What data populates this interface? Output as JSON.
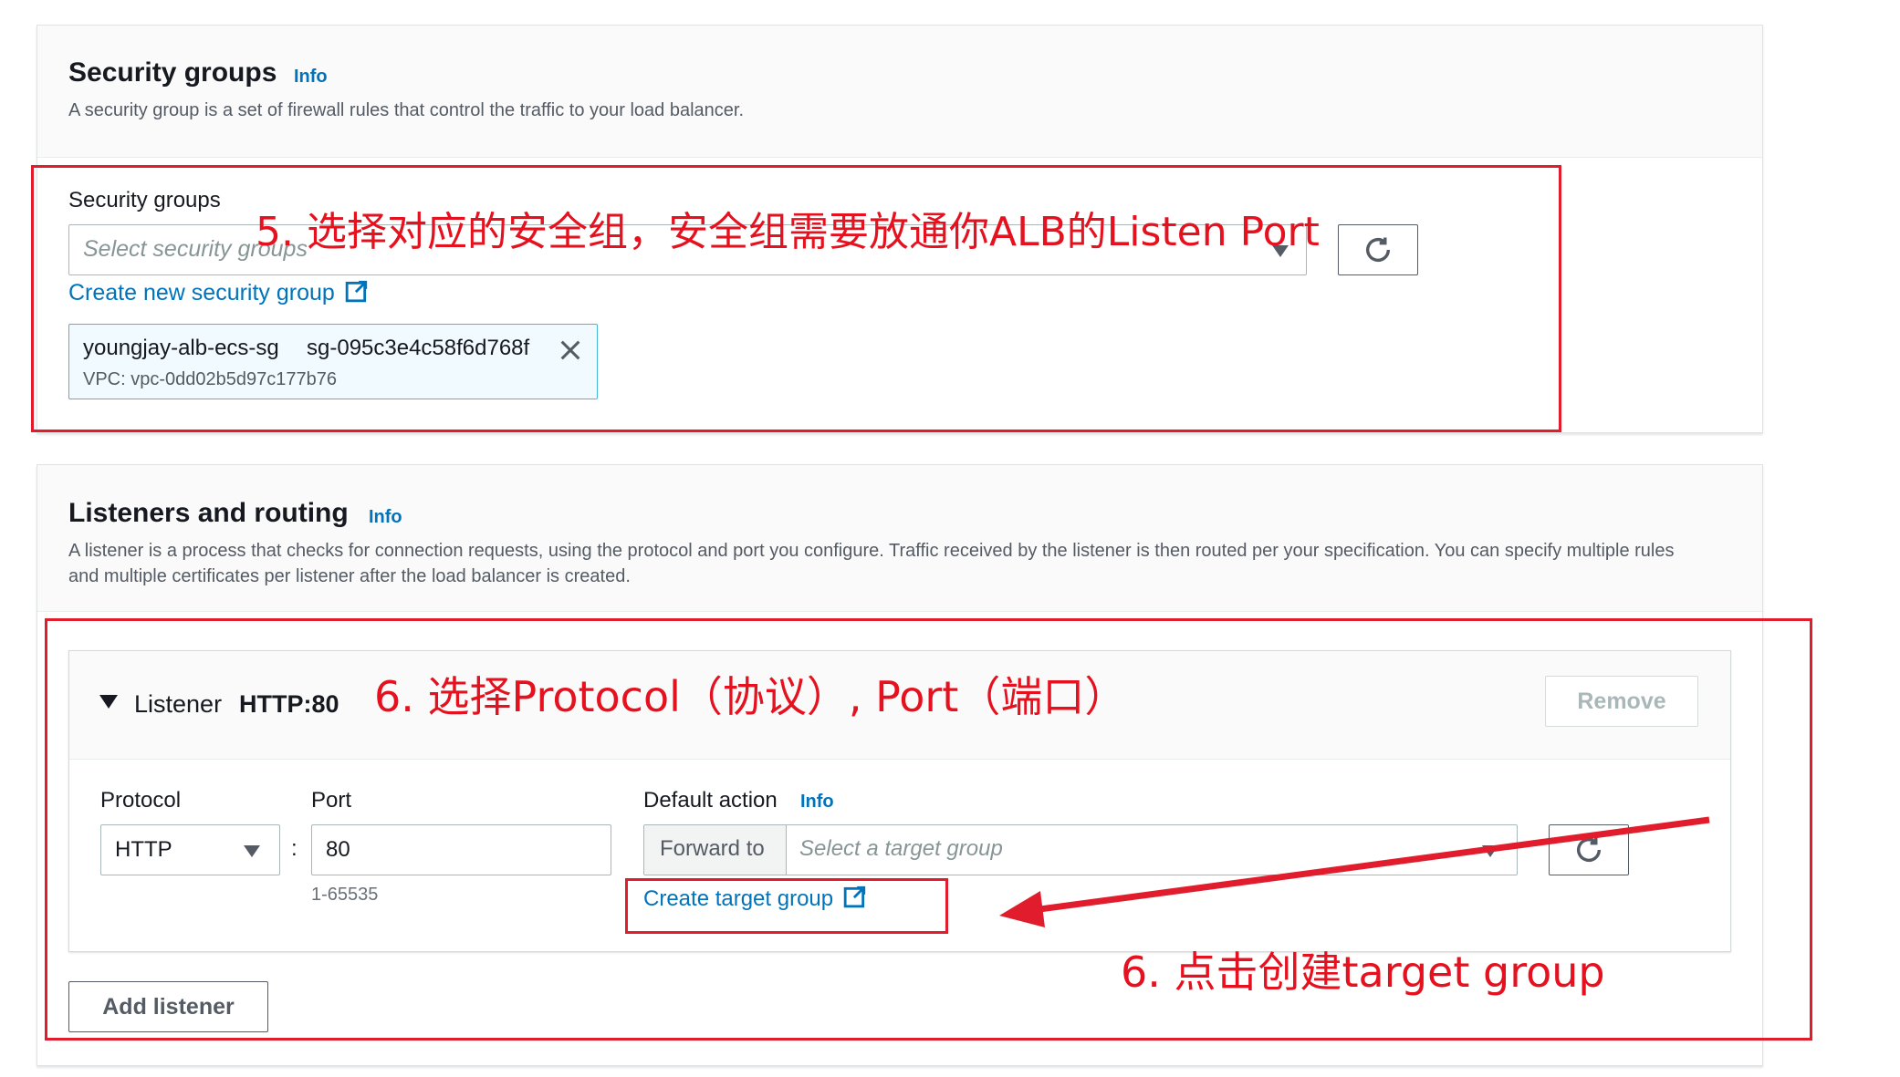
{
  "security_groups": {
    "title": "Security groups",
    "info": "Info",
    "description": "A security group is a set of firewall rules that control the traffic to your load balancer.",
    "field_label": "Security groups",
    "placeholder": "Select security groups",
    "create_link": "Create new security group",
    "selected": {
      "name": "youngjay-alb-ecs-sg",
      "id": "sg-095c3e4c58f6d768f",
      "vpc": "VPC: vpc-0dd02b5d97c177b76"
    }
  },
  "listeners": {
    "title": "Listeners and routing",
    "info": "Info",
    "description": "A listener is a process that checks for connection requests, using the protocol and port you configure. Traffic received by the listener is then routed per your specification. You can specify multiple rules and multiple certificates per listener after the load balancer is created.",
    "listener": {
      "label": "Listener",
      "name": "HTTP:80",
      "remove_button": "Remove",
      "protocol_label": "Protocol",
      "protocol_value": "HTTP",
      "separator": ":",
      "port_label": "Port",
      "port_value": "80",
      "port_hint": "1-65535",
      "default_action_label": "Default action",
      "default_action_info": "Info",
      "forward_to": "Forward to",
      "target_placeholder": "Select a target group",
      "create_target_link": "Create target group"
    },
    "add_listener_button": "Add listener"
  },
  "annotations": {
    "step5": "5. 选择对应的安全组，安全组需要放通你ALB的Listen Port",
    "step6_protocol": "6. 选择Protocol（协议）, Port（端口）",
    "step6_target": "6. 点击创建target group"
  },
  "colors": {
    "link": "#0073bb",
    "annotation_red": "#e11d2d",
    "selected_border": "#44b9d6",
    "selected_bg": "#f1faff"
  },
  "icons": [
    "caret-down-icon",
    "refresh-icon",
    "external-link-icon",
    "close-icon",
    "expand-triangle-icon"
  ]
}
